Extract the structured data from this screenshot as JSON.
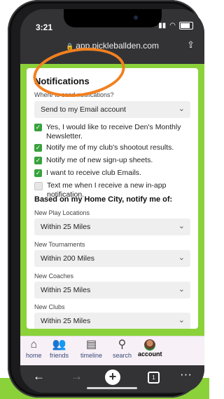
{
  "status": {
    "time": "3:21"
  },
  "browser": {
    "url": "app.pickleballden.com"
  },
  "card": {
    "title": "Notifications",
    "send_label": "Where to send notifications?",
    "send_value": "Send to my Email account",
    "options": [
      {
        "label": "Yes, I would like to receive Den's Monthly Newsletter.",
        "checked": true
      },
      {
        "label": "Notify me of my club's shootout results.",
        "checked": true
      },
      {
        "label": "Notify me of new sign-up sheets.",
        "checked": true
      },
      {
        "label": "I want to receive club Emails.",
        "checked": true
      },
      {
        "label": "Text me when I receive a new in-app notification.",
        "checked": false
      }
    ],
    "home_city_heading": "Based on my Home City, notify me of:",
    "fields": [
      {
        "label": "New Play Locations",
        "value": "Within 25 Miles"
      },
      {
        "label": "New Tournaments",
        "value": "Within 200 Miles"
      },
      {
        "label": "New Coaches",
        "value": "Within 25 Miles"
      },
      {
        "label": "New Clubs",
        "value": "Within 25 Miles"
      }
    ]
  },
  "nav": {
    "home": "home",
    "friends": "friends",
    "timeline": "timeline",
    "search": "search",
    "account": "account"
  },
  "browser_toolbar": {
    "tab_count": "1"
  },
  "colors": {
    "brand_green": "#8BD23A",
    "checkbox_green": "#37a23b",
    "annotation_orange": "#F2801F"
  }
}
